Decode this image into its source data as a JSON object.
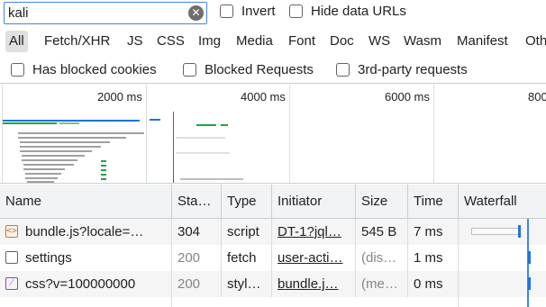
{
  "filter": {
    "value": "kali",
    "invert_label": "Invert",
    "hide_data_urls_label": "Hide data URLs"
  },
  "type_filters": [
    "All",
    "Fetch/XHR",
    "JS",
    "CSS",
    "Img",
    "Media",
    "Font",
    "Doc",
    "WS",
    "Wasm",
    "Manifest",
    "Oth"
  ],
  "active_type": "All",
  "options": {
    "blocked_cookies": "Has blocked cookies",
    "blocked_requests": "Blocked Requests",
    "third_party": "3rd-party requests"
  },
  "overview": {
    "ticks": [
      "2000 ms",
      "4000 ms",
      "6000 ms",
      "800"
    ]
  },
  "table": {
    "headers": [
      "Name",
      "Sta…",
      "Type",
      "Initiator",
      "Size",
      "Time",
      "Waterfall"
    ],
    "rows": [
      {
        "icon": "script-file-icon",
        "name": "bundle.js?locale=…",
        "status": "304",
        "type": "script",
        "initiator": "DT-1?jql…",
        "size": "545 B",
        "time": "7 ms"
      },
      {
        "icon": "document-icon",
        "name": "settings",
        "status": "200",
        "type": "fetch",
        "initiator": "user-acti…",
        "size": "(dis…",
        "time": "1 ms"
      },
      {
        "icon": "stylesheet-icon",
        "name": "css?v=100000000",
        "status": "200",
        "type": "styl…",
        "initiator": "bundle.j…",
        "size": "(me…",
        "time": "0 ms"
      }
    ]
  },
  "colors": {
    "accent": "#1a73e8",
    "redline": "#d32f2f",
    "script": "#e8710a",
    "style": "#9334e6"
  }
}
